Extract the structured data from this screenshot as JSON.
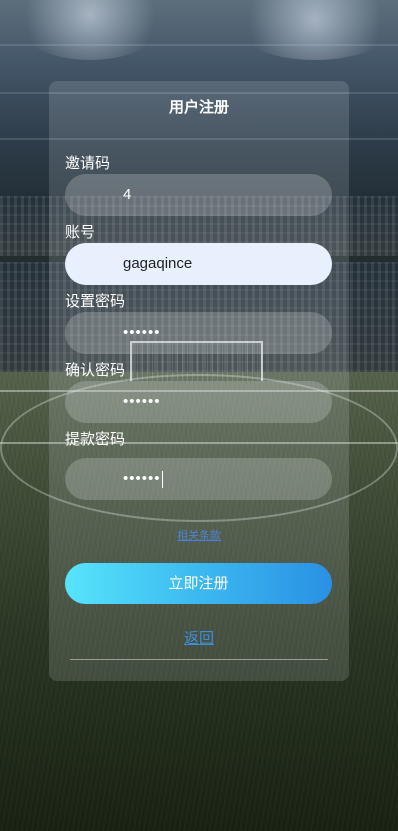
{
  "form": {
    "title": "用户注册",
    "invite_label": "邀请码",
    "invite_value": "4",
    "account_label": "账号",
    "account_value": "gagaqince",
    "password_label": "设置密码",
    "password_value": "••••••",
    "confirm_label": "确认密码",
    "confirm_value": "••••••",
    "withdraw_label": "提款密码",
    "withdraw_value": "••••••",
    "terms_link": "相关条款",
    "submit_label": "立即注册",
    "back_label": "返回"
  },
  "colors": {
    "submit_gradient_start": "#57e4fb",
    "submit_gradient_end": "#2a90e4",
    "link": "#3f8ede",
    "active_field": "#e8f0fe"
  }
}
